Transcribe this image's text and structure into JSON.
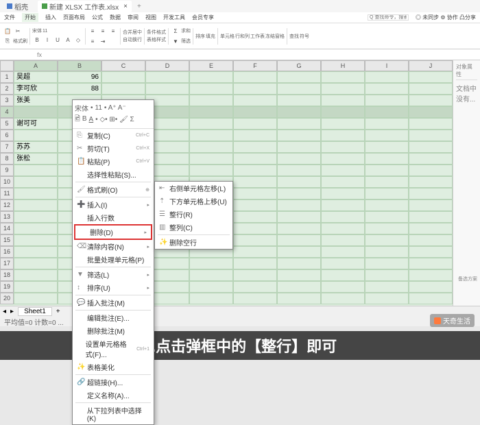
{
  "tabs": {
    "t1": "稻壳",
    "t2": "新建 XLSX 工作表.xlsx"
  },
  "menu": {
    "file": "文件",
    "start": "开始",
    "insert": "插入",
    "page": "页面布局",
    "formula": "公式",
    "data": "数据",
    "review": "审阅",
    "view": "视图",
    "dev": "开发工具",
    "member": "会员专享",
    "search_ph": "Q 查找命令，搜索模板",
    "help": "◎ 未同步 ⚙ 协作 凸分享"
  },
  "ribbon": {
    "font": "宋体",
    "size": "11",
    "labels": {
      "format": "格式刷",
      "merge": "合并居中",
      "wrap": "自动换行",
      "cond": "条件格式",
      "style": "表格样式",
      "sum": "求和",
      "filter": "筛选",
      "sort": "排序",
      "fill": "填充",
      "cell": "单元格",
      "row": "行和列",
      "sheet": "工作表",
      "freeze": "冻结窗格",
      "find": "查找",
      "symbol": "符号"
    }
  },
  "cols": [
    "A",
    "B",
    "C",
    "D",
    "E",
    "F",
    "G",
    "H",
    "I",
    "J"
  ],
  "data_rows": [
    {
      "a": "吴超",
      "b": "96"
    },
    {
      "a": "李可欣",
      "b": "88"
    },
    {
      "a": "张美",
      "b": ""
    },
    {
      "a": "",
      "b": ""
    },
    {
      "a": "谢可可",
      "b": ""
    },
    {
      "a": "",
      "b": ""
    },
    {
      "a": "苏苏",
      "b": ""
    },
    {
      "a": "张松",
      "b": ""
    }
  ],
  "ctx": {
    "toolbar_font": "宋体",
    "ts": "11",
    "copy": "复制(C)",
    "copy_sc": "Ctrl+C",
    "cut": "剪切(T)",
    "cut_sc": "Ctrl+X",
    "paste": "粘贴(P)",
    "paste_sc": "Ctrl+V",
    "paste_special": "选择性粘贴(S)...",
    "format_paint": "格式刷(O)",
    "insert": "插入(I)",
    "insert_rows": "插入行数",
    "delete": "删除(D)",
    "clear": "清除内容(N)",
    "batch": "批量处理单元格(P)",
    "filter": "筛选(L)",
    "sort": "排序(U)",
    "insert_comment": "插入批注(M)",
    "edit_comment": "编辑批注(E)...",
    "delete_comment": "删除批注(M)",
    "format_cells": "设置单元格格式(F)...",
    "fc_sc": "Ctrl+1",
    "table_beauty": "表格美化",
    "hyperlink": "超链接(H)...",
    "define_name": "定义名称(A)...",
    "from_dropdown": "从下拉列表中选择(K)"
  },
  "submenu": {
    "right": "右侧单元格左移(L)",
    "down": "下方单元格上移(U)",
    "row": "整行(R)",
    "col": "整列(C)",
    "del_blank": "删除空行"
  },
  "sheet_tab": "Sheet1",
  "status_txt": "平均值=0 计数=0 ...",
  "sidebar": {
    "title": "对象属性",
    "empty": "文档中没有...",
    "bottom": "备选方案"
  },
  "caption": "4.点击弹框中的【整行】即可",
  "watermark": "天奇生活"
}
